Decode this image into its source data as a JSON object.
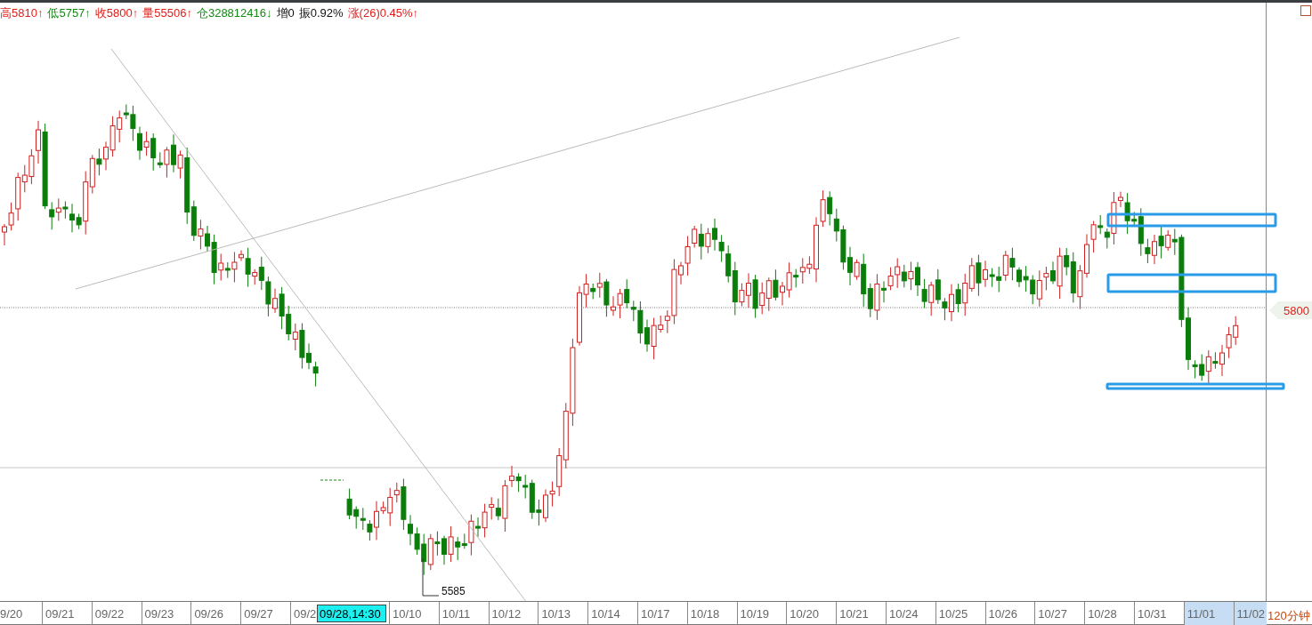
{
  "quote_bar": [
    {
      "text": "高5810↑",
      "color": "#e0201c"
    },
    {
      "text": "低5757↑",
      "color": "#138a13"
    },
    {
      "text": "收5800↑",
      "color": "#e0201c"
    },
    {
      "text": "量55506↑",
      "color": "#e0201c"
    },
    {
      "text": "仓328812416↓",
      "color": "#138a13"
    },
    {
      "text": "增0",
      "color": "#111111"
    },
    {
      "text": "振0.92%",
      "color": "#111111"
    },
    {
      "text": "涨(26)0.45%↑",
      "color": "#e0201c"
    }
  ],
  "chart": {
    "price_tag": "5800",
    "low_annotation": "5585"
  },
  "x_axis": [
    {
      "kind": "first",
      "text": "9/20",
      "highlighted": false
    },
    {
      "kind": "date",
      "text": "09/21",
      "highlighted": false
    },
    {
      "kind": "date",
      "text": "09/22",
      "highlighted": false
    },
    {
      "kind": "date",
      "text": "09/23",
      "highlighted": false
    },
    {
      "kind": "date",
      "text": "09/26",
      "highlighted": false
    },
    {
      "kind": "date",
      "text": "09/27",
      "highlighted": false
    },
    {
      "kind": "partial",
      "text": "09/2",
      "highlighted": false
    },
    {
      "kind": "cursor",
      "text": "09/28,14:30",
      "highlighted": false
    },
    {
      "kind": "date",
      "text": "10/10",
      "highlighted": false
    },
    {
      "kind": "date",
      "text": "10/11",
      "highlighted": false
    },
    {
      "kind": "date",
      "text": "10/12",
      "highlighted": false
    },
    {
      "kind": "date",
      "text": "10/13",
      "highlighted": false
    },
    {
      "kind": "date",
      "text": "10/14",
      "highlighted": false
    },
    {
      "kind": "date",
      "text": "10/17",
      "highlighted": false
    },
    {
      "kind": "date",
      "text": "10/18",
      "highlighted": false
    },
    {
      "kind": "date",
      "text": "10/19",
      "highlighted": false
    },
    {
      "kind": "date",
      "text": "10/20",
      "highlighted": false
    },
    {
      "kind": "date",
      "text": "10/21",
      "highlighted": false
    },
    {
      "kind": "date",
      "text": "10/24",
      "highlighted": false
    },
    {
      "kind": "date",
      "text": "10/25",
      "highlighted": false
    },
    {
      "kind": "date",
      "text": "10/26",
      "highlighted": false
    },
    {
      "kind": "date",
      "text": "10/27",
      "highlighted": false
    },
    {
      "kind": "date",
      "text": "10/28",
      "highlighted": false
    },
    {
      "kind": "date",
      "text": "10/31",
      "highlighted": false
    },
    {
      "kind": "date",
      "text": "11/01",
      "highlighted": true
    },
    {
      "kind": "last",
      "text": "11/02",
      "highlighted": true
    }
  ],
  "period": "120分钟"
}
